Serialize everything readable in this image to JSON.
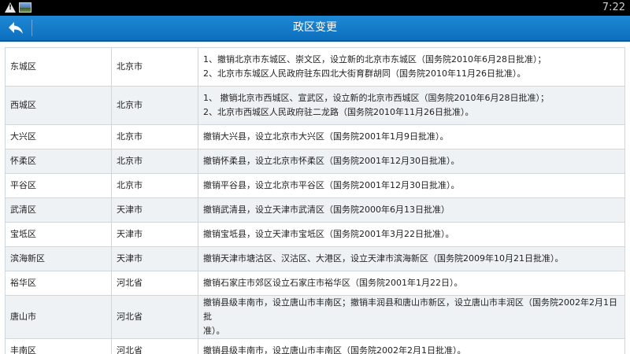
{
  "status_bar": {
    "time": "7:22",
    "icons": [
      "warning-icon",
      "image-notification-icon"
    ]
  },
  "app_bar": {
    "title": "政区变更",
    "back_icon": "back-arrow-icon",
    "color": "#1580cc"
  },
  "rows": [
    {
      "name": "东城区",
      "province": "北京市",
      "desc": [
        "1、撤销北京市东城区、崇文区，设立新的北京市东城区（国务院2010年6月28日批准）；",
        "2、北京市东城区人民政府驻东四北大街育群胡同（国务院2010年11月26日批准）。"
      ]
    },
    {
      "name": "西城区",
      "province": "北京市",
      "desc": [
        "1、 撤销北京市西城区、宣武区，设立新的北京市西城区（国务院2010年6月28日批准）；",
        "2、北京市西城区人民政府驻二龙路（国务院2010年11月26日批准）。"
      ]
    },
    {
      "name": "大兴区",
      "province": "北京市",
      "desc": [
        "撤销大兴县，设立北京市大兴区（国务院2001年1月9日批准）。"
      ]
    },
    {
      "name": "怀柔区",
      "province": "北京市",
      "desc": [
        "撤销怀柔县，设立北京市怀柔区（国务院2001年12月30日批准）。"
      ]
    },
    {
      "name": "平谷区",
      "province": "北京市",
      "desc": [
        "撤销平谷县，设立北京市平谷区（国务院2001年12月30日批准）。"
      ]
    },
    {
      "name": "武清区",
      "province": "天津市",
      "desc": [
        "撤销武清县，设立天津市武清区（国务院2000年6月13日批准）"
      ]
    },
    {
      "name": "宝坻区",
      "province": "天津市",
      "desc": [
        "撤销宝坻县，设立天津市宝坻区（国务院2001年3月22日批准）。"
      ]
    },
    {
      "name": "滨海新区",
      "province": "天津市",
      "desc": [
        "撤销天津市塘沽区、汉沽区、大港区，设立天津市滨海新区（国务院2009年10月21日批准）。"
      ]
    },
    {
      "name": "裕华区",
      "province": "河北省",
      "desc": [
        "撤销石家庄市郊区设立石家庄市裕华区（国务院2001年1月22日）。"
      ]
    },
    {
      "name": "唐山市",
      "province": "河北省",
      "desc": [
        "撤销县级丰南市，设立唐山市丰南区；撤销丰润县和唐山市新区，设立唐山市丰润区（国务院2002年2月1日批",
        "准）。"
      ]
    },
    {
      "name": "丰南区",
      "province": "河北省",
      "desc": [
        "撤销县级丰南市，设立唐山市丰南区（国务院2002年2月1日批准）。"
      ]
    }
  ]
}
